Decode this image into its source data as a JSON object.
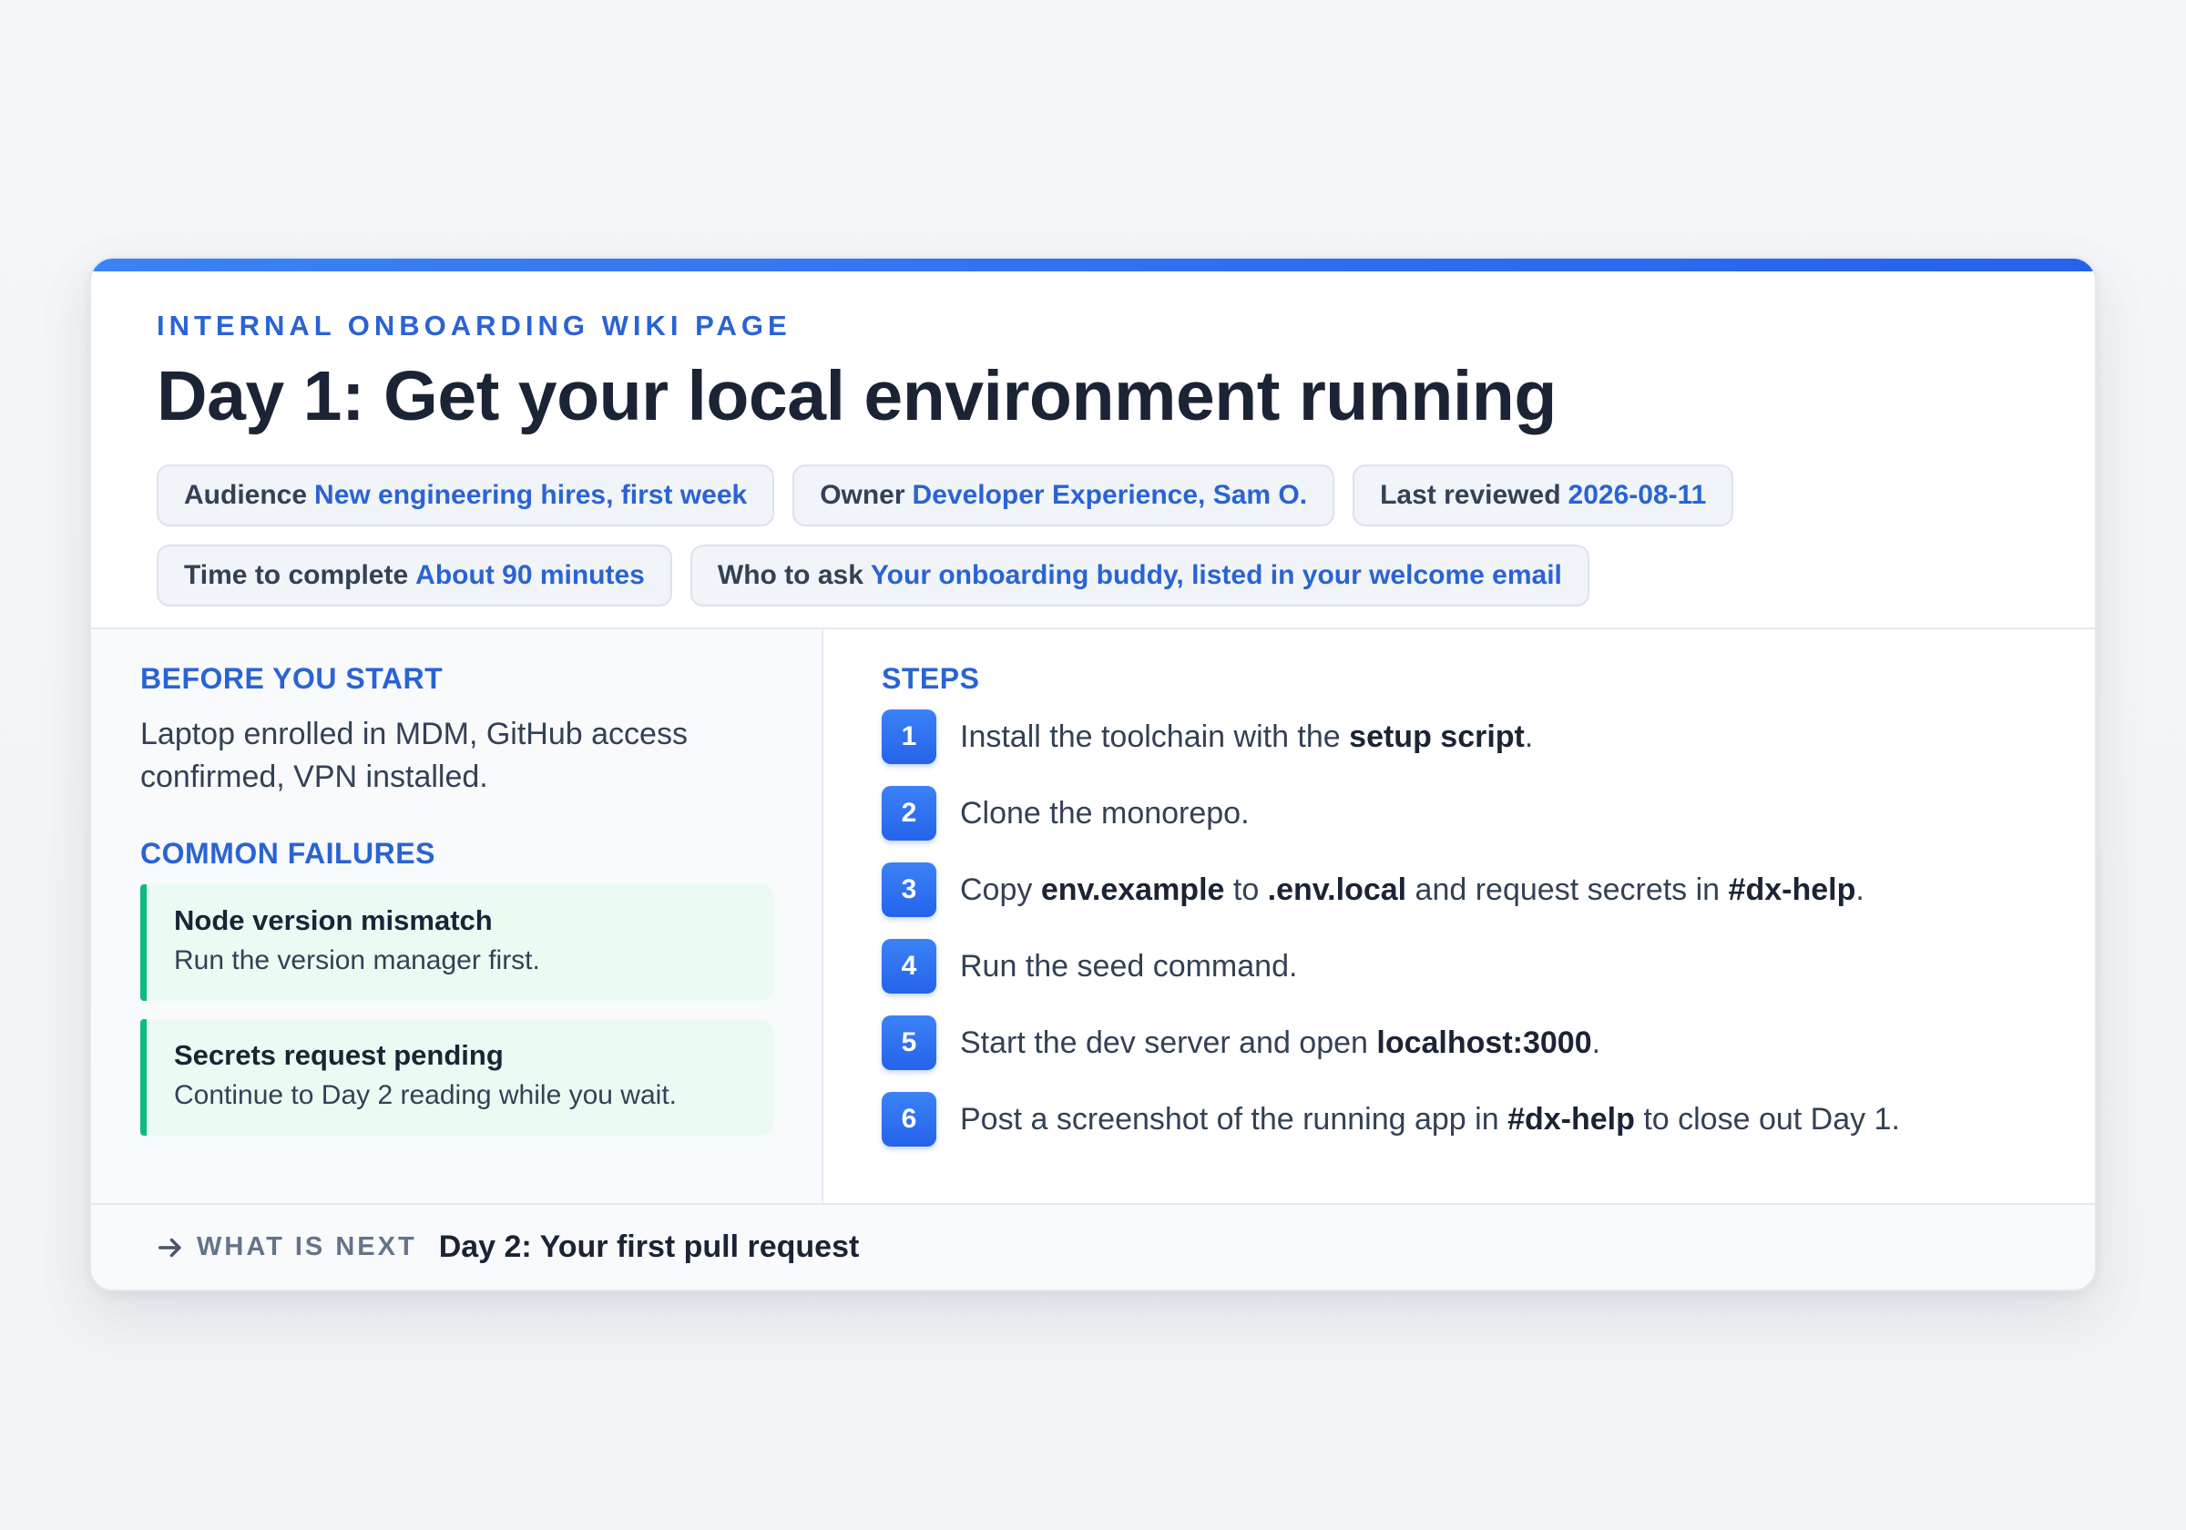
{
  "page": {
    "eyebrow": "INTERNAL ONBOARDING WIKI PAGE",
    "title": "Day 1: Get your local environment running"
  },
  "meta": [
    {
      "key": "Audience",
      "value": "New engineering hires, first week"
    },
    {
      "key": "Owner",
      "value": "Developer Experience, Sam O."
    },
    {
      "key": "Last reviewed",
      "value": "2026-08-11"
    },
    {
      "key": "Time to complete",
      "value": "About 90 minutes"
    },
    {
      "key": "Who to ask",
      "value": "Your onboarding buddy, listed in your welcome email"
    }
  ],
  "before": {
    "heading": "BEFORE YOU START",
    "text": "Laptop enrolled in MDM, GitHub access confirmed, VPN installed."
  },
  "failures": {
    "heading": "COMMON FAILURES",
    "items": [
      {
        "title": "Node version mismatch",
        "desc": "Run the version manager first."
      },
      {
        "title": "Secrets request pending",
        "desc": "Continue to Day 2 reading while you wait."
      }
    ]
  },
  "steps": {
    "heading": "STEPS",
    "items": [
      {
        "num": "1",
        "parts": [
          [
            "Install the toolchain with the ",
            false
          ],
          [
            "setup script",
            true
          ],
          [
            ".",
            false
          ]
        ]
      },
      {
        "num": "2",
        "parts": [
          [
            "Clone the monorepo.",
            false
          ]
        ]
      },
      {
        "num": "3",
        "parts": [
          [
            "Copy ",
            false
          ],
          [
            "env.example",
            true
          ],
          [
            " to ",
            false
          ],
          [
            ".env.local",
            true
          ],
          [
            " and request secrets in ",
            false
          ],
          [
            "#dx-help",
            true
          ],
          [
            ".",
            false
          ]
        ]
      },
      {
        "num": "4",
        "parts": [
          [
            "Run the seed command.",
            false
          ]
        ]
      },
      {
        "num": "5",
        "parts": [
          [
            "Start the dev server and open ",
            false
          ],
          [
            "localhost:3000",
            true
          ],
          [
            ".",
            false
          ]
        ]
      },
      {
        "num": "6",
        "parts": [
          [
            "Post a screenshot of the running app in ",
            false
          ],
          [
            "#dx-help",
            true
          ],
          [
            " to close out Day 1.",
            false
          ]
        ]
      }
    ]
  },
  "footer": {
    "label": "WHAT IS NEXT",
    "value": "Day 2: Your first pull request"
  },
  "colors": {
    "accent": "#2a63d4",
    "success": "#10b981"
  },
  "icons": {
    "footer": "arrow-right-icon"
  }
}
